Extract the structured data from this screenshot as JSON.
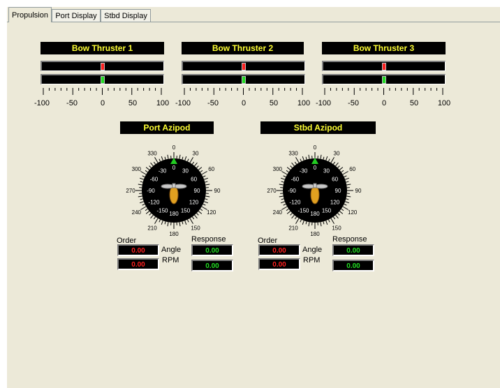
{
  "tabs": [
    {
      "label": "Propulsion",
      "active": true
    },
    {
      "label": "Port Display",
      "active": false
    },
    {
      "label": "Stbd Display",
      "active": false
    }
  ],
  "thrusters": [
    {
      "title": "Bow Thruster 1",
      "order": 0,
      "response": 0
    },
    {
      "title": "Bow Thruster 2",
      "order": 0,
      "response": 0
    },
    {
      "title": "Bow Thruster 3",
      "order": 0,
      "response": 0
    }
  ],
  "scale_labels": [
    "-100",
    "-50",
    "0",
    "50",
    "100"
  ],
  "azipods": [
    {
      "title": "Port Azipod",
      "order_label": "Order",
      "response_label": "Response",
      "angle_label": "Angle",
      "rpm_label": "RPM",
      "order_angle": "0.00",
      "order_rpm": "0.00",
      "response_angle": "0.00",
      "response_rpm": "0.00"
    },
    {
      "title": "Stbd Azipod",
      "order_label": "Order",
      "response_label": "Response",
      "angle_label": "Angle",
      "rpm_label": "RPM",
      "order_angle": "0.00",
      "order_rpm": "0.00",
      "response_angle": "0.00",
      "response_rpm": "0.00"
    }
  ],
  "dial_outer_labels": [
    "0",
    "30",
    "60",
    "90",
    "120",
    "150",
    "180",
    "210",
    "240",
    "270",
    "300",
    "330"
  ],
  "dial_inner_labels": [
    "0",
    "30",
    "60",
    "90",
    "120",
    "150",
    "180",
    "-150",
    "-120",
    "-90",
    "-60",
    "-30"
  ],
  "colors": {
    "title_text": "#ffff33",
    "order_value": "#ff2020",
    "response_value": "#22dd22",
    "pointer": "#22cc22",
    "pod": "#e0a020"
  }
}
